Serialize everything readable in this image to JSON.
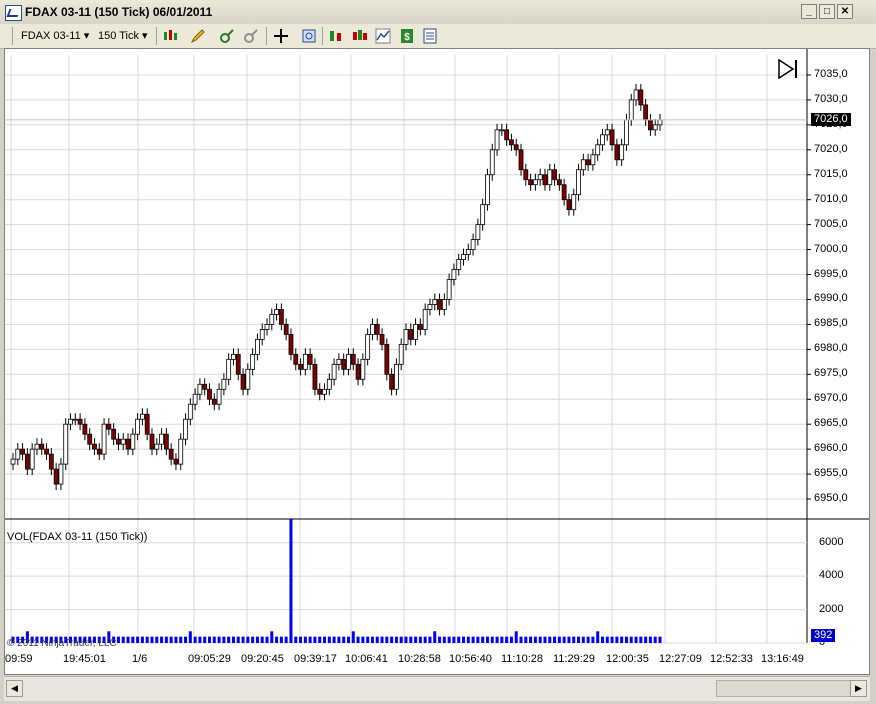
{
  "window": {
    "title": "FDAX 03-11 (150 Tick)  06/01/2011",
    "minimize": "_",
    "maximize": "□",
    "close": "✕"
  },
  "toolbar": {
    "instrument": "FDAX 03-11",
    "interval": "150 Tick",
    "dropdown_arrow": "▾"
  },
  "price_panel": {
    "y_ticks": [
      "7035,0",
      "7030,0",
      "7025,0",
      "7020,0",
      "7015,0",
      "7010,0",
      "7005,0",
      "7000,0",
      "6995,0",
      "6990,0",
      "6985,0",
      "6980,0",
      "6975,0",
      "6970,0",
      "6965,0",
      "6960,0",
      "6955,0",
      "6950,0"
    ],
    "last_price": "7026,0",
    "last_price_color": "#000000"
  },
  "volume_panel": {
    "label": "VOL(FDAX 03-11 (150 Tick))",
    "y_ticks": [
      "6000",
      "4000",
      "2000",
      "0"
    ],
    "last_volume": "392",
    "bar_color": "#0000ff",
    "copyright": "© 2011 NinjaTrader, LLC"
  },
  "time_axis": {
    "labels": [
      "09:59",
      "19:45:01",
      "1/6",
      "09:05:29",
      "09:20:45",
      "09:39:17",
      "10:06:41",
      "10:28:58",
      "10:56:40",
      "11:10:28",
      "11:29:29",
      "12:00:35",
      "12:27:09",
      "12:52:33",
      "13:16:49"
    ]
  },
  "colors": {
    "up_candle": "#ffffff",
    "down_candle": "#800000",
    "grid": "#d8d8d8"
  },
  "chart_data": {
    "type": "candlestick",
    "ylim": [
      6946,
      7039
    ],
    "closes": [
      6958,
      6960,
      6959,
      6956,
      6960,
      6961,
      6960,
      6959,
      6956,
      6953,
      6957,
      6965,
      6966,
      6966,
      6965,
      6963,
      6961,
      6960,
      6959,
      6965,
      6964,
      6962,
      6961,
      6962,
      6960,
      6963,
      6966,
      6967,
      6963,
      6960,
      6961,
      6963,
      6960,
      6958,
      6957,
      6962,
      6966,
      6969,
      6971,
      6973,
      6972,
      6970,
      6969,
      6972,
      6974,
      6978,
      6979,
      6975,
      6972,
      6976,
      6979,
      6982,
      6984,
      6985,
      6987,
      6988,
      6985,
      6983,
      6979,
      6977,
      6976,
      6979,
      6977,
      6972,
      6971,
      6972,
      6974,
      6977,
      6978,
      6976,
      6979,
      6977,
      6974,
      6978,
      6983,
      6985,
      6983,
      6981,
      6975,
      6972,
      6977,
      6981,
      6984,
      6982,
      6985,
      6984,
      6988,
      6989,
      6990,
      6988,
      6990,
      6994,
      6996,
      6998,
      6999,
      7000,
      7002,
      7005,
      7009,
      7015,
      7020,
      7024,
      7024,
      7022,
      7021,
      7020,
      7016,
      7014,
      7013,
      7014,
      7015,
      7013,
      7016,
      7014,
      7013,
      7010,
      7008,
      7011,
      7016,
      7018,
      7017,
      7019,
      7021,
      7023,
      7024,
      7021,
      7018,
      7021,
      7026,
      7030,
      7032,
      7029,
      7026,
      7024,
      7025,
      7026
    ]
  }
}
